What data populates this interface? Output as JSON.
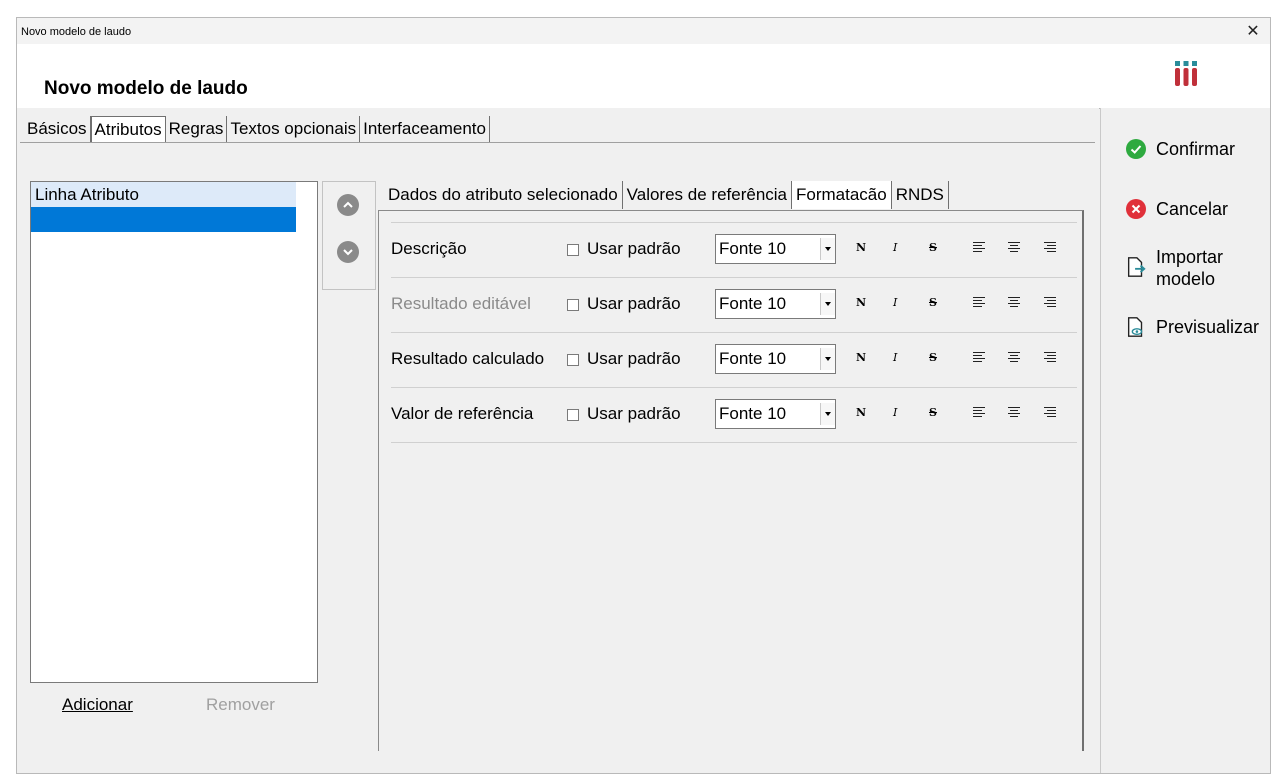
{
  "window": {
    "title": "Novo modelo de laudo",
    "close_glyph": "✕"
  },
  "header": {
    "title": "Novo modelo de laudo",
    "logo_icon": "test-tubes-icon"
  },
  "tabs": [
    {
      "label": "Básicos"
    },
    {
      "label": "Atributos"
    },
    {
      "label": "Regras"
    },
    {
      "label": "Textos opcionais"
    },
    {
      "label": "Interfaceamento"
    }
  ],
  "attributes_list": {
    "items": [
      "Linha Atributo",
      ""
    ]
  },
  "list_actions": {
    "add": "Adicionar",
    "remove": "Remover"
  },
  "inner_tabs": [
    {
      "label": "Dados do atributo selecionado"
    },
    {
      "label": "Valores de referência"
    },
    {
      "label": "Formatacão"
    },
    {
      "label": "RNDS"
    }
  ],
  "format_rows": [
    {
      "label": "Descrição",
      "checkbox": "Usar padrão",
      "font": "Fonte 10"
    },
    {
      "label": "Resultado editável",
      "checkbox": "Usar padrão",
      "font": "Fonte 10"
    },
    {
      "label": "Resultado calculado",
      "checkbox": "Usar padrão",
      "font": "Fonte 10"
    },
    {
      "label": "Valor de referência",
      "checkbox": "Usar padrão",
      "font": "Fonte 10"
    }
  ],
  "format_buttons": {
    "bold": "N",
    "italic": "I",
    "strike": "S"
  },
  "side_actions": {
    "confirm": "Confirmar",
    "cancel": "Cancelar",
    "import": "Importar modelo",
    "preview": "Previsualizar"
  },
  "colors": {
    "accent": "#0078d7",
    "confirm": "#2eaa3f",
    "cancel": "#e0303a",
    "logo_red": "#c0303a",
    "logo_teal": "#2a8c9a"
  }
}
